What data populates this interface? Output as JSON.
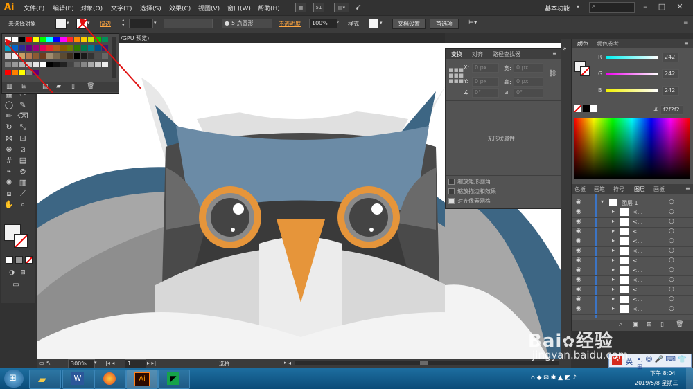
{
  "app": {
    "logo": "Ai"
  },
  "menu": [
    "文件(F)",
    "编辑(E)",
    "对象(O)",
    "文字(T)",
    "选择(S)",
    "效果(C)",
    "视图(V)",
    "窗口(W)",
    "帮助(H)"
  ],
  "menubar": {
    "workspace": "基本功能",
    "page_num": "51"
  },
  "control": {
    "no_selection": "未选择对象",
    "stroke_label": "描边",
    "brush": "5 点圆形",
    "opacity_label": "不透明度",
    "opacity_value": "100%",
    "style_label": "样式",
    "doc_setup": "文档设置",
    "prefs": "首选项"
  },
  "doc_tab": "/GPU 预览)",
  "transform_panel": {
    "tabs": [
      "变换",
      "对齐",
      "路径查找器"
    ],
    "x_label": "X:",
    "y_label": "Y:",
    "w_label": "宽:",
    "h_label": "高:",
    "x": "0 px",
    "y": "0 px",
    "w": "0 px",
    "h": "0 px",
    "rot": "0°",
    "shear": "0°",
    "empty": "无形状属性",
    "opts": [
      "缩放矩形圆角",
      "缩放描边和效果",
      "对齐像素网格"
    ]
  },
  "color_panel": {
    "tabs": [
      "颜色",
      "颜色参考"
    ],
    "r_label": "R",
    "g_label": "G",
    "b_label": "B",
    "r": "242",
    "g": "242",
    "b": "242",
    "hex_prefix": "#",
    "hex": "f2f2f2"
  },
  "layers_panel": {
    "tabs": [
      "色板",
      "画笔",
      "符号",
      "图层",
      "画板"
    ],
    "top_layer": "图层 1",
    "sublayer_label": "<..."
  },
  "status": {
    "zoom": "300%",
    "artboard": "1",
    "mode": "选择"
  },
  "taskbar": {
    "time": "下午 8:04",
    "date": "2019/5/8 星期三",
    "ime": "英"
  },
  "watermark": {
    "brand": "Bai",
    "brand_cn": "经验",
    "site": "jingyan.baidu.com"
  },
  "colors": {
    "owl_blue": "#6b8ba6",
    "owl_dark_blue": "#3d6684",
    "owl_dark": "#3d3d3d",
    "owl_grey": "#a5a5a5",
    "eye_ring": "#e6953a",
    "beak": "#e6953a",
    "annotation_red": "#e01010"
  }
}
